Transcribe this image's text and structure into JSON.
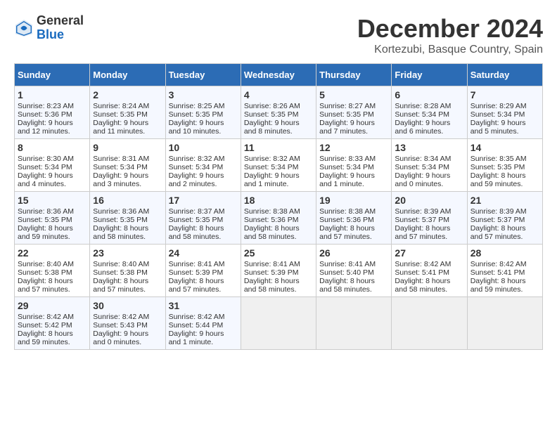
{
  "header": {
    "logo_general": "General",
    "logo_blue": "Blue",
    "title": "December 2024",
    "subtitle": "Kortezubi, Basque Country, Spain"
  },
  "weekdays": [
    "Sunday",
    "Monday",
    "Tuesday",
    "Wednesday",
    "Thursday",
    "Friday",
    "Saturday"
  ],
  "rows": [
    [
      {
        "day": "1",
        "sunrise": "Sunrise: 8:23 AM",
        "sunset": "Sunset: 5:36 PM",
        "daylight": "Daylight: 9 hours and 12 minutes."
      },
      {
        "day": "2",
        "sunrise": "Sunrise: 8:24 AM",
        "sunset": "Sunset: 5:35 PM",
        "daylight": "Daylight: 9 hours and 11 minutes."
      },
      {
        "day": "3",
        "sunrise": "Sunrise: 8:25 AM",
        "sunset": "Sunset: 5:35 PM",
        "daylight": "Daylight: 9 hours and 10 minutes."
      },
      {
        "day": "4",
        "sunrise": "Sunrise: 8:26 AM",
        "sunset": "Sunset: 5:35 PM",
        "daylight": "Daylight: 9 hours and 8 minutes."
      },
      {
        "day": "5",
        "sunrise": "Sunrise: 8:27 AM",
        "sunset": "Sunset: 5:35 PM",
        "daylight": "Daylight: 9 hours and 7 minutes."
      },
      {
        "day": "6",
        "sunrise": "Sunrise: 8:28 AM",
        "sunset": "Sunset: 5:34 PM",
        "daylight": "Daylight: 9 hours and 6 minutes."
      },
      {
        "day": "7",
        "sunrise": "Sunrise: 8:29 AM",
        "sunset": "Sunset: 5:34 PM",
        "daylight": "Daylight: 9 hours and 5 minutes."
      }
    ],
    [
      {
        "day": "8",
        "sunrise": "Sunrise: 8:30 AM",
        "sunset": "Sunset: 5:34 PM",
        "daylight": "Daylight: 9 hours and 4 minutes."
      },
      {
        "day": "9",
        "sunrise": "Sunrise: 8:31 AM",
        "sunset": "Sunset: 5:34 PM",
        "daylight": "Daylight: 9 hours and 3 minutes."
      },
      {
        "day": "10",
        "sunrise": "Sunrise: 8:32 AM",
        "sunset": "Sunset: 5:34 PM",
        "daylight": "Daylight: 9 hours and 2 minutes."
      },
      {
        "day": "11",
        "sunrise": "Sunrise: 8:32 AM",
        "sunset": "Sunset: 5:34 PM",
        "daylight": "Daylight: 9 hours and 1 minute."
      },
      {
        "day": "12",
        "sunrise": "Sunrise: 8:33 AM",
        "sunset": "Sunset: 5:34 PM",
        "daylight": "Daylight: 9 hours and 1 minute."
      },
      {
        "day": "13",
        "sunrise": "Sunrise: 8:34 AM",
        "sunset": "Sunset: 5:34 PM",
        "daylight": "Daylight: 9 hours and 0 minutes."
      },
      {
        "day": "14",
        "sunrise": "Sunrise: 8:35 AM",
        "sunset": "Sunset: 5:35 PM",
        "daylight": "Daylight: 8 hours and 59 minutes."
      }
    ],
    [
      {
        "day": "15",
        "sunrise": "Sunrise: 8:36 AM",
        "sunset": "Sunset: 5:35 PM",
        "daylight": "Daylight: 8 hours and 59 minutes."
      },
      {
        "day": "16",
        "sunrise": "Sunrise: 8:36 AM",
        "sunset": "Sunset: 5:35 PM",
        "daylight": "Daylight: 8 hours and 58 minutes."
      },
      {
        "day": "17",
        "sunrise": "Sunrise: 8:37 AM",
        "sunset": "Sunset: 5:35 PM",
        "daylight": "Daylight: 8 hours and 58 minutes."
      },
      {
        "day": "18",
        "sunrise": "Sunrise: 8:38 AM",
        "sunset": "Sunset: 5:36 PM",
        "daylight": "Daylight: 8 hours and 58 minutes."
      },
      {
        "day": "19",
        "sunrise": "Sunrise: 8:38 AM",
        "sunset": "Sunset: 5:36 PM",
        "daylight": "Daylight: 8 hours and 57 minutes."
      },
      {
        "day": "20",
        "sunrise": "Sunrise: 8:39 AM",
        "sunset": "Sunset: 5:37 PM",
        "daylight": "Daylight: 8 hours and 57 minutes."
      },
      {
        "day": "21",
        "sunrise": "Sunrise: 8:39 AM",
        "sunset": "Sunset: 5:37 PM",
        "daylight": "Daylight: 8 hours and 57 minutes."
      }
    ],
    [
      {
        "day": "22",
        "sunrise": "Sunrise: 8:40 AM",
        "sunset": "Sunset: 5:38 PM",
        "daylight": "Daylight: 8 hours and 57 minutes."
      },
      {
        "day": "23",
        "sunrise": "Sunrise: 8:40 AM",
        "sunset": "Sunset: 5:38 PM",
        "daylight": "Daylight: 8 hours and 57 minutes."
      },
      {
        "day": "24",
        "sunrise": "Sunrise: 8:41 AM",
        "sunset": "Sunset: 5:39 PM",
        "daylight": "Daylight: 8 hours and 57 minutes."
      },
      {
        "day": "25",
        "sunrise": "Sunrise: 8:41 AM",
        "sunset": "Sunset: 5:39 PM",
        "daylight": "Daylight: 8 hours and 58 minutes."
      },
      {
        "day": "26",
        "sunrise": "Sunrise: 8:41 AM",
        "sunset": "Sunset: 5:40 PM",
        "daylight": "Daylight: 8 hours and 58 minutes."
      },
      {
        "day": "27",
        "sunrise": "Sunrise: 8:42 AM",
        "sunset": "Sunset: 5:41 PM",
        "daylight": "Daylight: 8 hours and 58 minutes."
      },
      {
        "day": "28",
        "sunrise": "Sunrise: 8:42 AM",
        "sunset": "Sunset: 5:41 PM",
        "daylight": "Daylight: 8 hours and 59 minutes."
      }
    ],
    [
      {
        "day": "29",
        "sunrise": "Sunrise: 8:42 AM",
        "sunset": "Sunset: 5:42 PM",
        "daylight": "Daylight: 8 hours and 59 minutes."
      },
      {
        "day": "30",
        "sunrise": "Sunrise: 8:42 AM",
        "sunset": "Sunset: 5:43 PM",
        "daylight": "Daylight: 9 hours and 0 minutes."
      },
      {
        "day": "31",
        "sunrise": "Sunrise: 8:42 AM",
        "sunset": "Sunset: 5:44 PM",
        "daylight": "Daylight: 9 hours and 1 minute."
      },
      null,
      null,
      null,
      null
    ]
  ]
}
